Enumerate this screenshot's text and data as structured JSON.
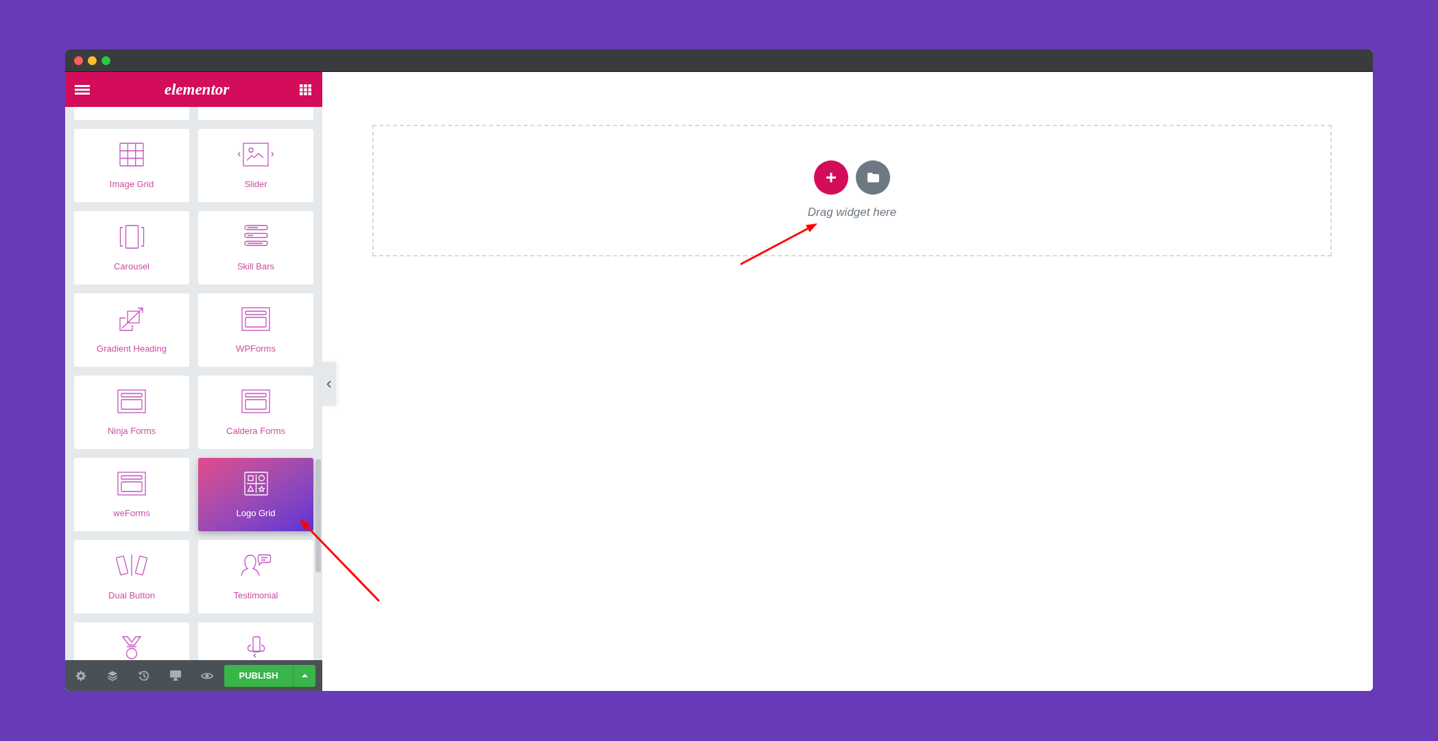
{
  "editor": {
    "logo": "elementor",
    "widgets": [
      {
        "selected": false
      },
      {
        "selected": false
      },
      {
        "label": "Image Grid",
        "selected": false
      },
      {
        "label": "Slider",
        "selected": false
      },
      {
        "label": "Carousel",
        "selected": false
      },
      {
        "label": "Skill Bars",
        "selected": false
      },
      {
        "label": "Gradient Heading",
        "selected": false
      },
      {
        "label": "WPForms",
        "selected": false
      },
      {
        "label": "Ninja Forms",
        "selected": false
      },
      {
        "label": "Caldera Forms",
        "selected": false
      },
      {
        "label": "weForms",
        "selected": false
      },
      {
        "label": "Logo Grid",
        "selected": true
      },
      {
        "label": "Dual Button",
        "selected": false
      },
      {
        "label": "Testimonial",
        "selected": false
      },
      {
        "selected": false
      },
      {
        "selected": false
      }
    ],
    "publish_button": "PUBLISH"
  },
  "canvas": {
    "drop_hint": "Drag widget here"
  }
}
